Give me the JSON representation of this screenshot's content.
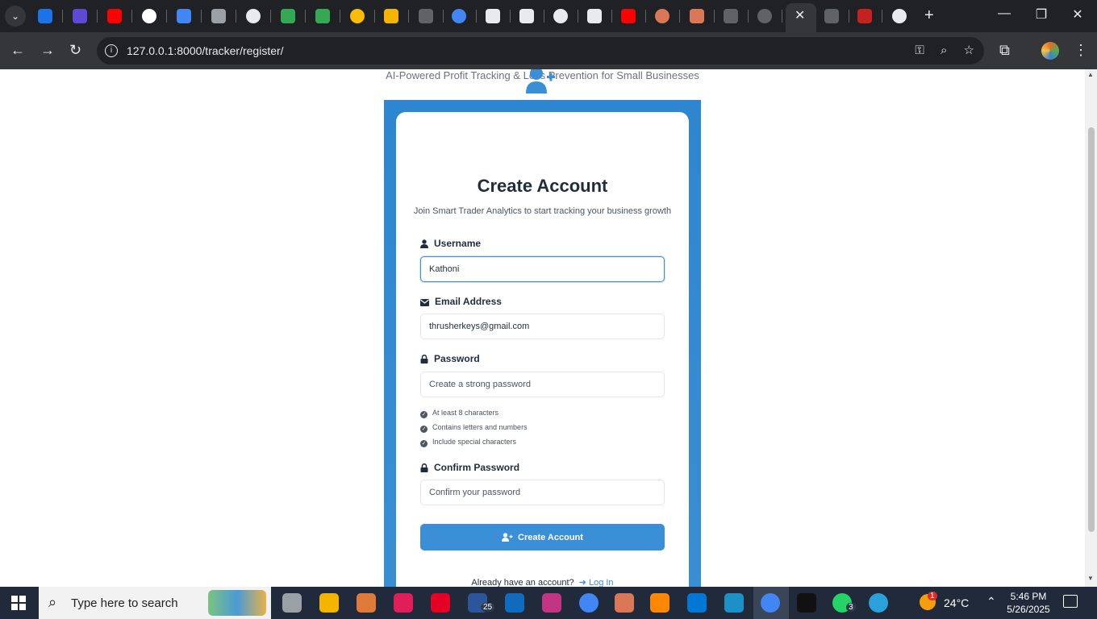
{
  "browser": {
    "url": "127.0.0.1:8000/tracker/register/",
    "tab_colors": [
      "#1a73e8",
      "#5f48d6",
      "#ff0000",
      "#ffffff",
      "#4285f4",
      "#9aa0a6",
      "#e8eaed",
      "#34a853",
      "#34a853",
      "#fbbc04",
      "#f4b400",
      "#5f6368",
      "#4285f4",
      "#e8eaed",
      "#e8eaed",
      "#e8eaed",
      "#e8eaed",
      "#ff0000",
      "#d97757",
      "#d97757",
      "#5f6368",
      "#5f6368",
      "#5f6368",
      "#c5221f",
      "#e8eaed"
    ]
  },
  "page": {
    "tagline": "AI-Powered Profit Tracking & Loss Prevention for Small Businesses",
    "title": "Create Account",
    "subtitle": "Join Smart Trader Analytics to start tracking your business growth",
    "fields": {
      "username": {
        "label": "Username",
        "value": "Kathoni"
      },
      "email": {
        "label": "Email Address",
        "value": "thrusherkeys@gmail.com"
      },
      "password": {
        "label": "Password",
        "placeholder": "Create a strong password"
      },
      "confirm": {
        "label": "Confirm Password",
        "placeholder": "Confirm your password"
      }
    },
    "requirements": [
      "At least 8 characters",
      "Contains letters and numbers",
      "Include special characters"
    ],
    "submit_label": "Create Account",
    "login_prompt": "Already have an account?",
    "login_link": "Log In",
    "accent_color": "#3a8fd6"
  },
  "taskbar": {
    "search_placeholder": "Type here to search",
    "mail_badge": "25",
    "whatsapp_badge": "3",
    "weather_badge": "1",
    "temperature": "24°C",
    "time": "5:46 PM",
    "date": "5/26/2025"
  }
}
